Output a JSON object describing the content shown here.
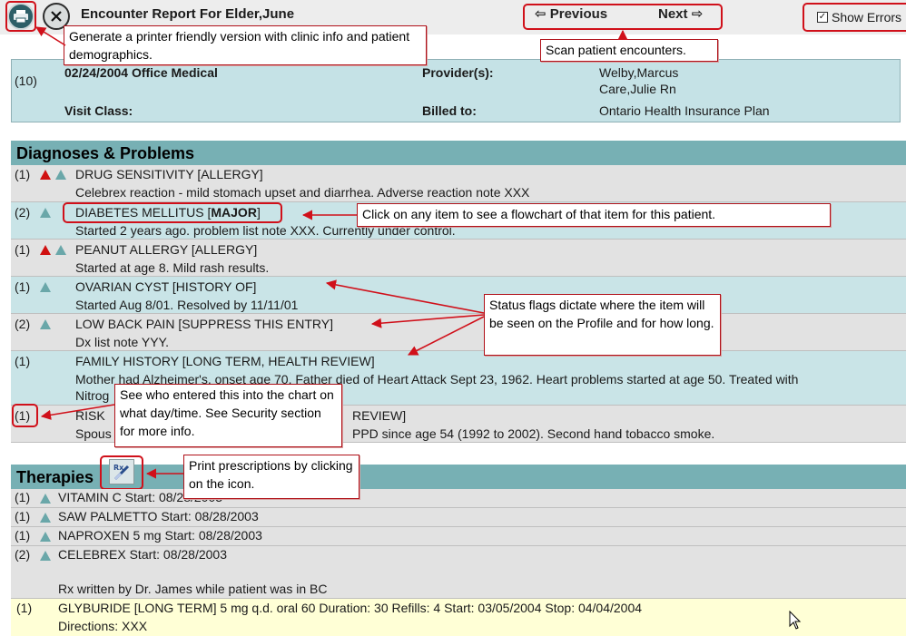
{
  "header": {
    "title": "Encounter Report For Elder,June",
    "previous_label": "Previous",
    "next_label": "Next",
    "show_errors_label": "Show Errors",
    "show_errors_checked": true
  },
  "encounter": {
    "count": "(10)",
    "date_type": "02/24/2004 Office Medical",
    "provider_label": "Provider(s):",
    "providers": [
      "Welby,Marcus",
      "Care,Julie Rn"
    ],
    "visit_class_label": "Visit Class:",
    "billed_to_label": "Billed to:",
    "billed_to": "Ontario Health Insurance Plan"
  },
  "diagnoses": {
    "heading": "Diagnoses & Problems",
    "items": [
      {
        "count": "(1)",
        "title": "DRUG SENSITIVITY [ALLERGY]",
        "note": "Celebrex reaction - mild stomach upset and diarrhea. Adverse reaction note XXX"
      },
      {
        "count": "(2)",
        "title_pre": "DIABETES MELLITUS [",
        "title_bold": "MAJOR",
        "title_post": "]",
        "note": "Started 2 years ago. problem list note XXX. Currently under control."
      },
      {
        "count": "(1)",
        "title": "PEANUT ALLERGY [ALLERGY]",
        "note": "Started at age 8. Mild rash results."
      },
      {
        "count": "(1)",
        "title": "OVARIAN CYST [HISTORY OF]",
        "note": "Started Aug 8/01. Resolved by 11/11/01"
      },
      {
        "count": "(2)",
        "title": "LOW BACK PAIN [SUPPRESS THIS ENTRY]",
        "note": "Dx list note YYY."
      },
      {
        "count": "(1)",
        "title": "FAMILY HISTORY [LONG TERM, HEALTH REVIEW]",
        "note": "Mother had Alzheimer's, onset age 70. Father died of Heart Attack Sept 23, 1962. Heart problems started at age 50. Treated with",
        "note2": "Nitrog"
      },
      {
        "count": "(1)",
        "title_pre": "RISK",
        "title_post": "REVIEW]",
        "note_pre": "Spous",
        "note_post": "PPD since age 54 (1992 to 2002). Second hand tobacco smoke."
      }
    ]
  },
  "therapies": {
    "heading": "Therapies",
    "items": [
      {
        "count": "(1)",
        "text": "VITAMIN C Start: 08/28/2003"
      },
      {
        "count": "(1)",
        "text": "SAW PALMETTO Start: 08/28/2003"
      },
      {
        "count": "(1)",
        "text": "NAPROXEN 5 mg Start: 08/28/2003"
      },
      {
        "count": "(2)",
        "text": "CELEBREX Start: 08/28/2003",
        "note": "Rx written by Dr. James while patient was in BC"
      },
      {
        "count": "(1)",
        "text": "GLYBURIDE [LONG TERM] 5 mg q.d. oral 60 Duration: 30 Refills: 4 Start: 03/05/2004 Stop: 04/04/2004",
        "note": "Directions: XXX"
      }
    ]
  },
  "callouts": {
    "printer": "Generate a printer friendly version with clinic info and patient demographics.",
    "scan": "Scan patient encounters.",
    "flowchart": "Click on any item to see a flowchart of that item for this patient.",
    "status": "Status flags dictate where the item will be seen on the Profile and for how long.",
    "entered": "See who entered this into the chart on what day/time.  See Security section for more info.",
    "print_rx": "Print prescriptions by clicking on the icon."
  },
  "colors": {
    "accent_red": "#d0101a",
    "section_teal": "#77b0b4",
    "row_teal": "#c9e4e7"
  }
}
